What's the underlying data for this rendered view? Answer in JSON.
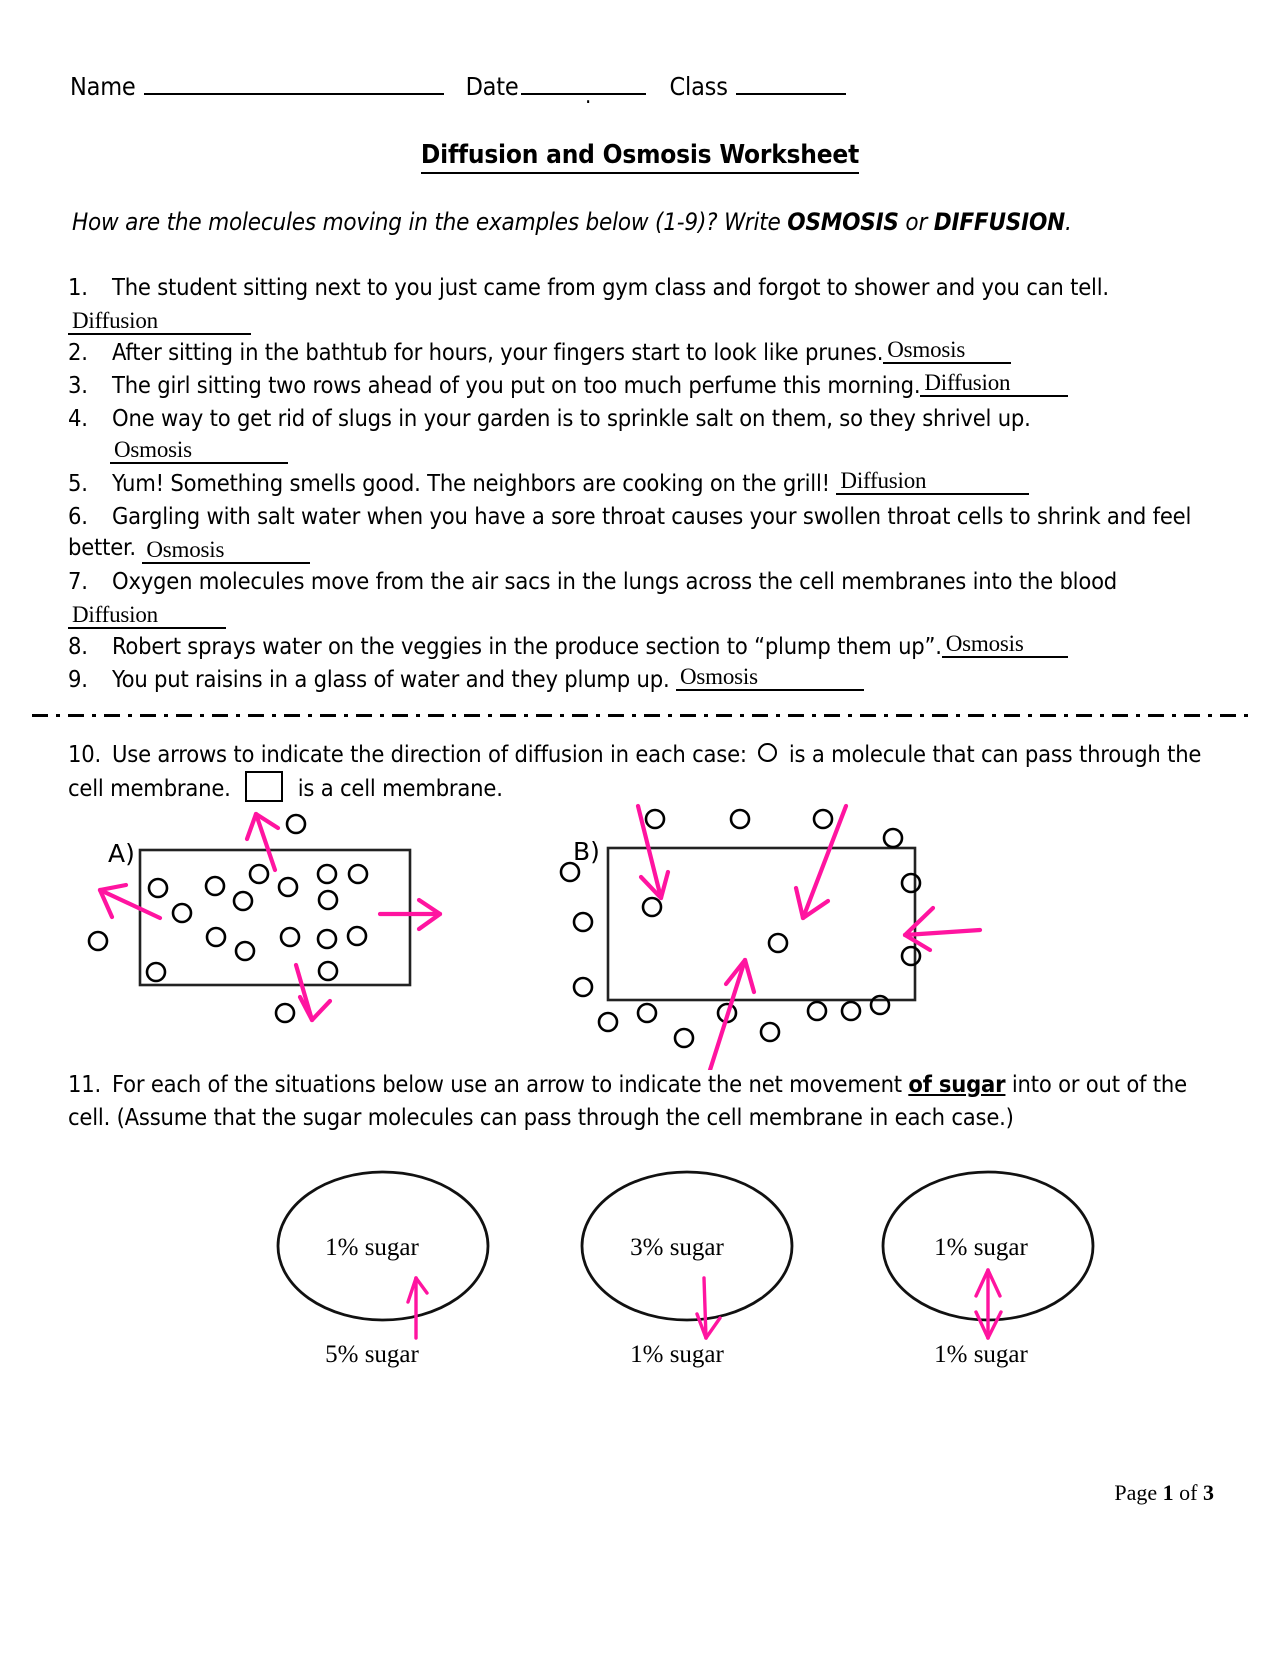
{
  "header": {
    "name_label": "Name",
    "date_label": "Date",
    "date_mark": ".",
    "class_label": "Class"
  },
  "title": "Diffusion and Osmosis Worksheet",
  "prompt": {
    "lead": "How are the molecules moving in the examples below (1-9)?  Write ",
    "option_a": "OSMOSIS",
    "joiner": " or ",
    "option_b": "DIFFUSION",
    "tail": "."
  },
  "questions": [
    {
      "num": "1.",
      "text": "The student sitting next to you just came from gym class and forgot to shower and you can tell.",
      "answer": "Diffusion"
    },
    {
      "num": "2.",
      "text": "After sitting in the bathtub for hours, your fingers start to look like prunes.",
      "answer": "Osmosis"
    },
    {
      "num": "3.",
      "text": "The girl sitting two rows ahead of you put on too much perfume this morning.",
      "answer": "Diffusion"
    },
    {
      "num": "4.",
      "text": "One way to get rid of slugs in your garden is to sprinkle salt on them, so they shrivel up.",
      "answer": "Osmosis"
    },
    {
      "num": "5.",
      "text": "Yum! Something smells good. The neighbors are cooking on the grill!",
      "answer": "Diffusion"
    },
    {
      "num": "6.",
      "text": "Gargling with salt water when you have a sore throat causes your swollen throat cells to shrink and feel better.",
      "answer": "Osmosis"
    },
    {
      "num": "7.",
      "text": "Oxygen molecules move from the air sacs in the lungs across the cell membranes into the blood",
      "answer": "Diffusion"
    },
    {
      "num": "8.",
      "text": "Robert sprays water on the veggies in the produce section to “plump them up”.",
      "answer": "Osmosis"
    },
    {
      "num": "9.",
      "text": "You put raisins in a glass of water and they plump up.",
      "answer": "Osmosis"
    }
  ],
  "q10": {
    "num": "10.",
    "part1": "Use arrows to indicate the direction of diffusion in each case:",
    "part2": "is a molecule that can pass through the cell membrane.",
    "part3": "is a cell membrane.",
    "diagram_a_label": "A)",
    "diagram_b_label": "B)"
  },
  "q11": {
    "num": "11.",
    "part1": "For each of the situations below use an arrow to indicate the net movement ",
    "emphasis": "of sugar",
    "part2": " into or out of the cell.  (Assume that the sugar molecules can pass through the cell membrane in each case.)"
  },
  "cells": [
    {
      "inside": "1% sugar",
      "outside": "5% sugar",
      "arrow": "up"
    },
    {
      "inside": "3% sugar",
      "outside": "1% sugar",
      "arrow": "down"
    },
    {
      "inside": "1% sugar",
      "outside": "1% sugar",
      "arrow": "both"
    }
  ],
  "footer": {
    "prefix": "Page ",
    "page": "1",
    "mid": " of ",
    "total": "3"
  },
  "colors": {
    "ink": "#000000",
    "annotation": "#FF14A0"
  }
}
